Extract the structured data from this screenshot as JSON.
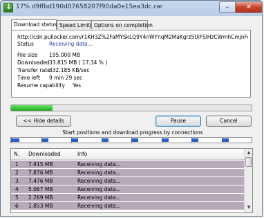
{
  "window": {
    "title": "17% d9ffbd190d07658207f90da0e15ea3dc.rar",
    "min_glyph": "–",
    "close_glyph": "✕"
  },
  "tabs": [
    {
      "label": "Download status"
    },
    {
      "label": "Speed Limiter"
    },
    {
      "label": "Options on completion"
    }
  ],
  "status": {
    "url": "http://cdn.pullocker.com/r1KH3Z%2FaMYSkLQ9Y4nWYnqM2MaKgrz5UiFSlHzCWmhCmjnFoy1BN",
    "status_label": "Status",
    "status_value": "Receiving data...",
    "rows": [
      {
        "label": "File size",
        "value": "195.000  MB"
      },
      {
        "label": "Downloaded",
        "value": "33.815  MB  ( 17.34 % )"
      },
      {
        "label": "Transfer rate",
        "value": "332.185  KB/sec"
      },
      {
        "label": "Time left",
        "value": "9 min 29 sec"
      },
      {
        "label": "Resume capability",
        "value": "Yes"
      }
    ]
  },
  "progress": {
    "fraction": 0.1734
  },
  "buttons": {
    "hide_details": "<< Hide details",
    "pause": "Pause",
    "cancel": "Cancel"
  },
  "connections": {
    "label": "Start positions and download progress by connections",
    "segments": [
      {
        "start": 0.0,
        "len": 0.035
      },
      {
        "start": 0.125,
        "len": 0.03
      },
      {
        "start": 0.25,
        "len": 0.028
      },
      {
        "start": 0.375,
        "len": 0.03
      },
      {
        "start": 0.5,
        "len": 0.028
      },
      {
        "start": 0.625,
        "len": 0.03
      },
      {
        "start": 0.75,
        "len": 0.028
      },
      {
        "start": 0.875,
        "len": 0.03
      }
    ]
  },
  "connection_list": {
    "headers": {
      "n": "N.",
      "downloaded": "Downloaded",
      "info": "Info"
    },
    "rows": [
      {
        "n": "1",
        "downloaded": "7.915  MB",
        "info": "Receiving data..."
      },
      {
        "n": "2",
        "downloaded": "7.876  MB",
        "info": "Receiving data..."
      },
      {
        "n": "3",
        "downloaded": "7.476  MB",
        "info": "Receiving data..."
      },
      {
        "n": "4",
        "downloaded": "5.067  MB",
        "info": "Receiving data..."
      },
      {
        "n": "5",
        "downloaded": "2.269  MB",
        "info": "Receiving data..."
      },
      {
        "n": "6",
        "downloaded": "1.853  MB",
        "info": "Receiving data..."
      }
    ]
  }
}
